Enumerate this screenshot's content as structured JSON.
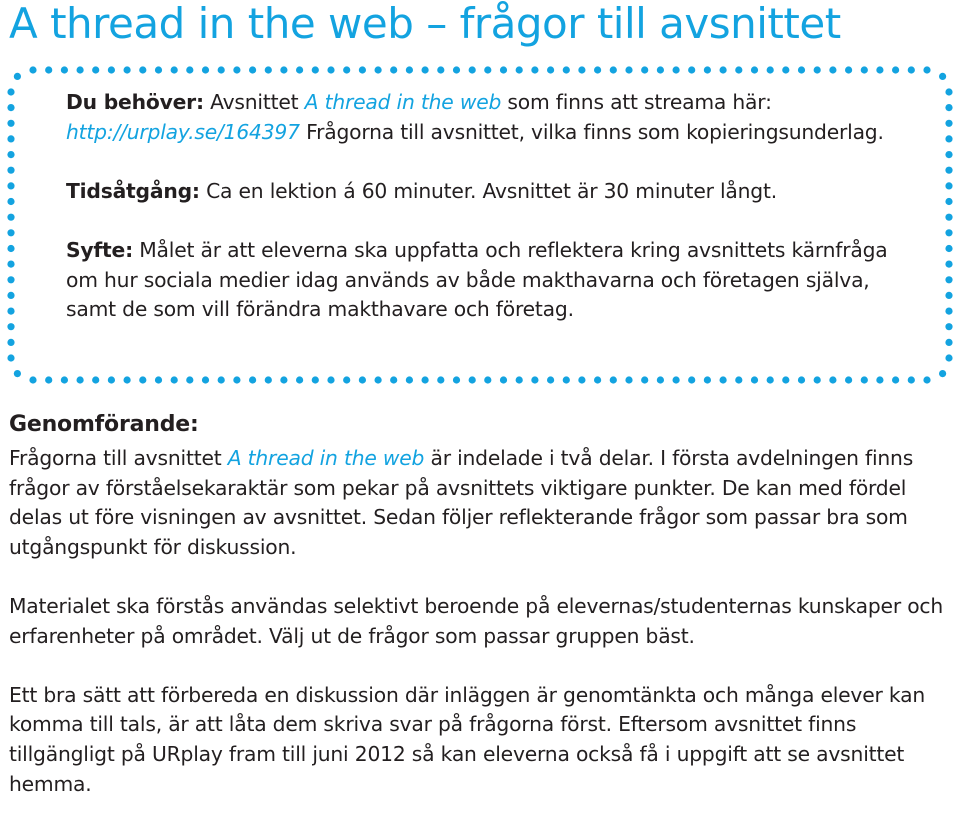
{
  "document": {
    "title": "A thread in the web – frågor till avsnittet",
    "accent_color": "#13a3e0",
    "border_style": "dotted-rounded-box",
    "info_box": {
      "du_behover": {
        "label": "Du behöver:",
        "text_before": " Avsnittet ",
        "episode_title": "A thread in the web",
        "text_middle": " som finns att streama här: ",
        "url": "http://urplay.se/164397",
        "text_after": " Frågorna till avsnittet, vilka finns som kopieringsunderlag."
      },
      "tidsatgang": {
        "label": "Tidsåtgång:",
        "text": " Ca en lektion á 60 minuter. Avsnittet är 30 minuter långt."
      },
      "syfte": {
        "label": "Syfte:",
        "text": " Målet är att eleverna ska uppfatta och reflektera kring avsnittets kärnfråga om hur sociala medier idag används av både makthavarna och företagen själva, samt de som vill förändra makthavare och företag."
      }
    },
    "genomforande": {
      "heading": "Genomförande:",
      "paragraph1": {
        "text_before": "Frågorna till avsnittet ",
        "episode_title": "A thread in the web",
        "text_after": " är indelade i två delar. I första avdelningen finns  frågor av förståelsekaraktär som pekar på avsnittets viktigare punkter. De kan med fördel delas ut före visningen av avsnittet. Sedan följer reflekterande frågor som passar bra som utgångspunkt för diskussion."
      },
      "paragraph2": "Materialet ska förstås användas selektivt beroende på elevernas/studenternas kunskaper och erfarenheter på området. Välj ut de frågor som passar gruppen bäst.",
      "paragraph3": "Ett bra sätt att förbereda en diskussion där inläggen är genomtänkta och många elever kan komma till tals, är att låta dem skriva svar på frågorna först. Eftersom avsnittet finns tillgängligt på URplay fram till juni 2012 så kan eleverna också få i uppgift att se avsnittet hemma."
    }
  }
}
